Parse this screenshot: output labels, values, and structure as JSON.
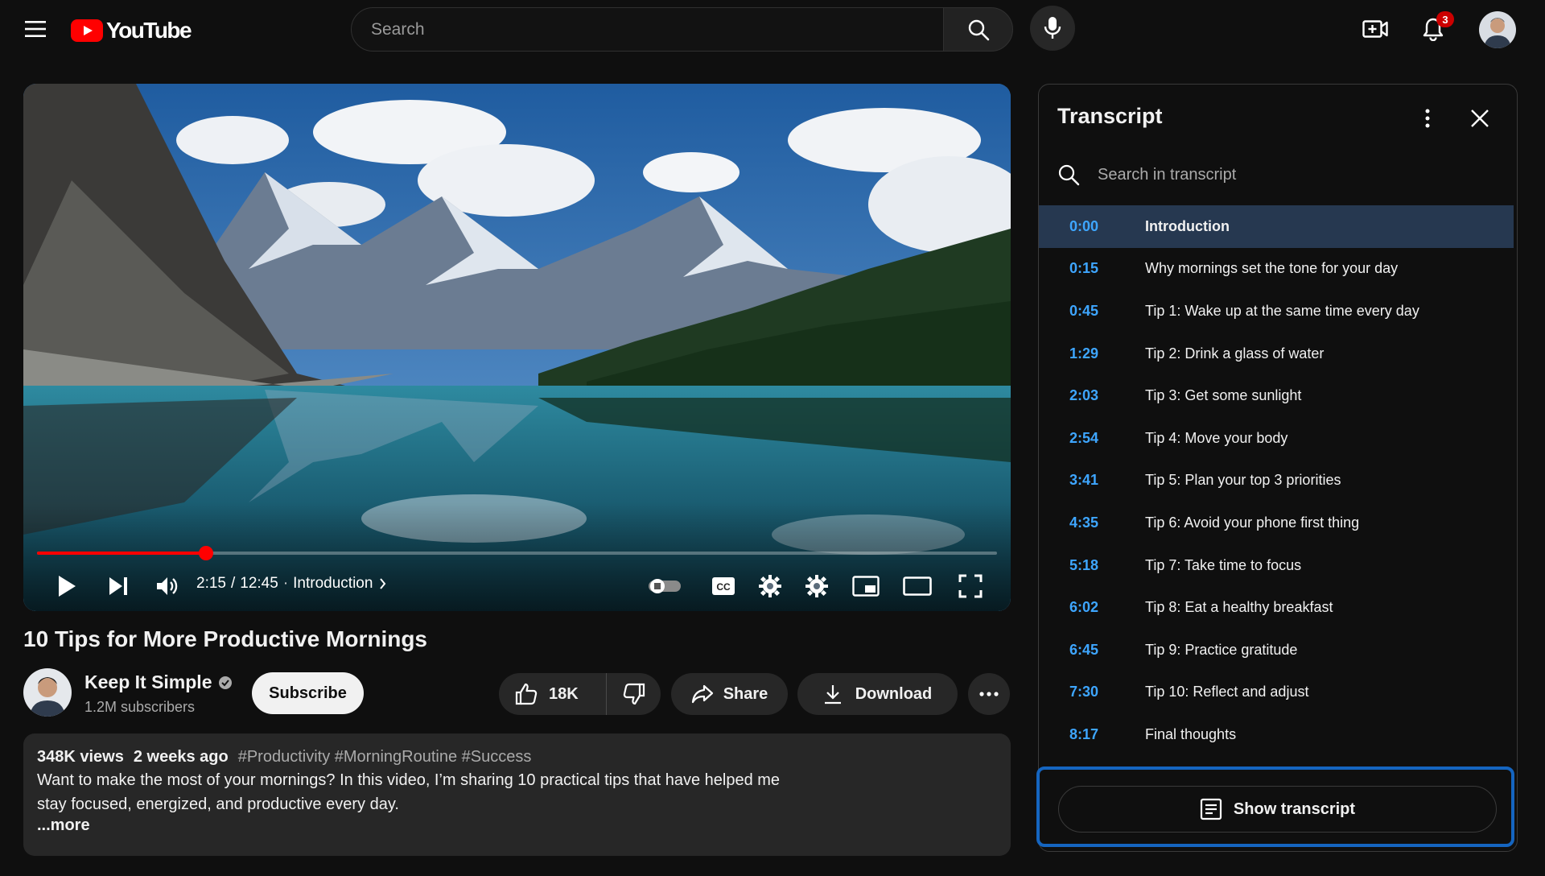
{
  "header": {
    "logo_text": "YouTube",
    "search_placeholder": "Search",
    "notification_count": "3"
  },
  "player": {
    "current_time": "2:15",
    "duration": "12:45",
    "separator": "/",
    "chapter": "Introduction",
    "progress_fraction": 0.176
  },
  "video": {
    "title": "10 Tips for More Productive Mornings"
  },
  "channel": {
    "name": "Keep It Simple",
    "subscribers": "1.2M subscribers",
    "subscribe_label": "Subscribe"
  },
  "actions": {
    "likes": "18K",
    "share_label": "Share",
    "download_label": "Download"
  },
  "description": {
    "views": "348K views",
    "age": "2 weeks ago",
    "tags": "#Productivity #MorningRoutine #Success",
    "text": "Want to make the most of your mornings? In this video, I’m sharing 10 practical tips that have helped me stay focused, energized, and productive every day.",
    "more_label": "...more"
  },
  "transcript": {
    "title": "Transcript",
    "search_placeholder": "Search in transcript",
    "show_label": "Show transcript",
    "segments": [
      {
        "time": "0:00",
        "text": "Introduction"
      },
      {
        "time": "0:15",
        "text": "Why mornings set the tone for your day"
      },
      {
        "time": "0:45",
        "text": "Tip 1: Wake up at the same time every day"
      },
      {
        "time": "1:29",
        "text": "Tip 2: Drink a glass of water"
      },
      {
        "time": "2:03",
        "text": "Tip 3: Get some sunlight"
      },
      {
        "time": "2:54",
        "text": "Tip 4: Move your body"
      },
      {
        "time": "3:41",
        "text": "Tip 5: Plan your top 3 priorities"
      },
      {
        "time": "4:35",
        "text": "Tip 6: Avoid your phone first thing"
      },
      {
        "time": "5:18",
        "text": "Tip 7: Take time to focus"
      },
      {
        "time": "6:02",
        "text": "Tip 8: Eat a healthy breakfast"
      },
      {
        "time": "6:45",
        "text": "Tip 9: Practice gratitude"
      },
      {
        "time": "7:30",
        "text": "Tip 10: Reflect and adjust"
      },
      {
        "time": "8:17",
        "text": "Final thoughts"
      }
    ]
  },
  "colors": {
    "brand_red": "#ff0000",
    "link_blue": "#3ea6ff",
    "focus_outline": "#1565c0",
    "active_row": "#263850"
  }
}
